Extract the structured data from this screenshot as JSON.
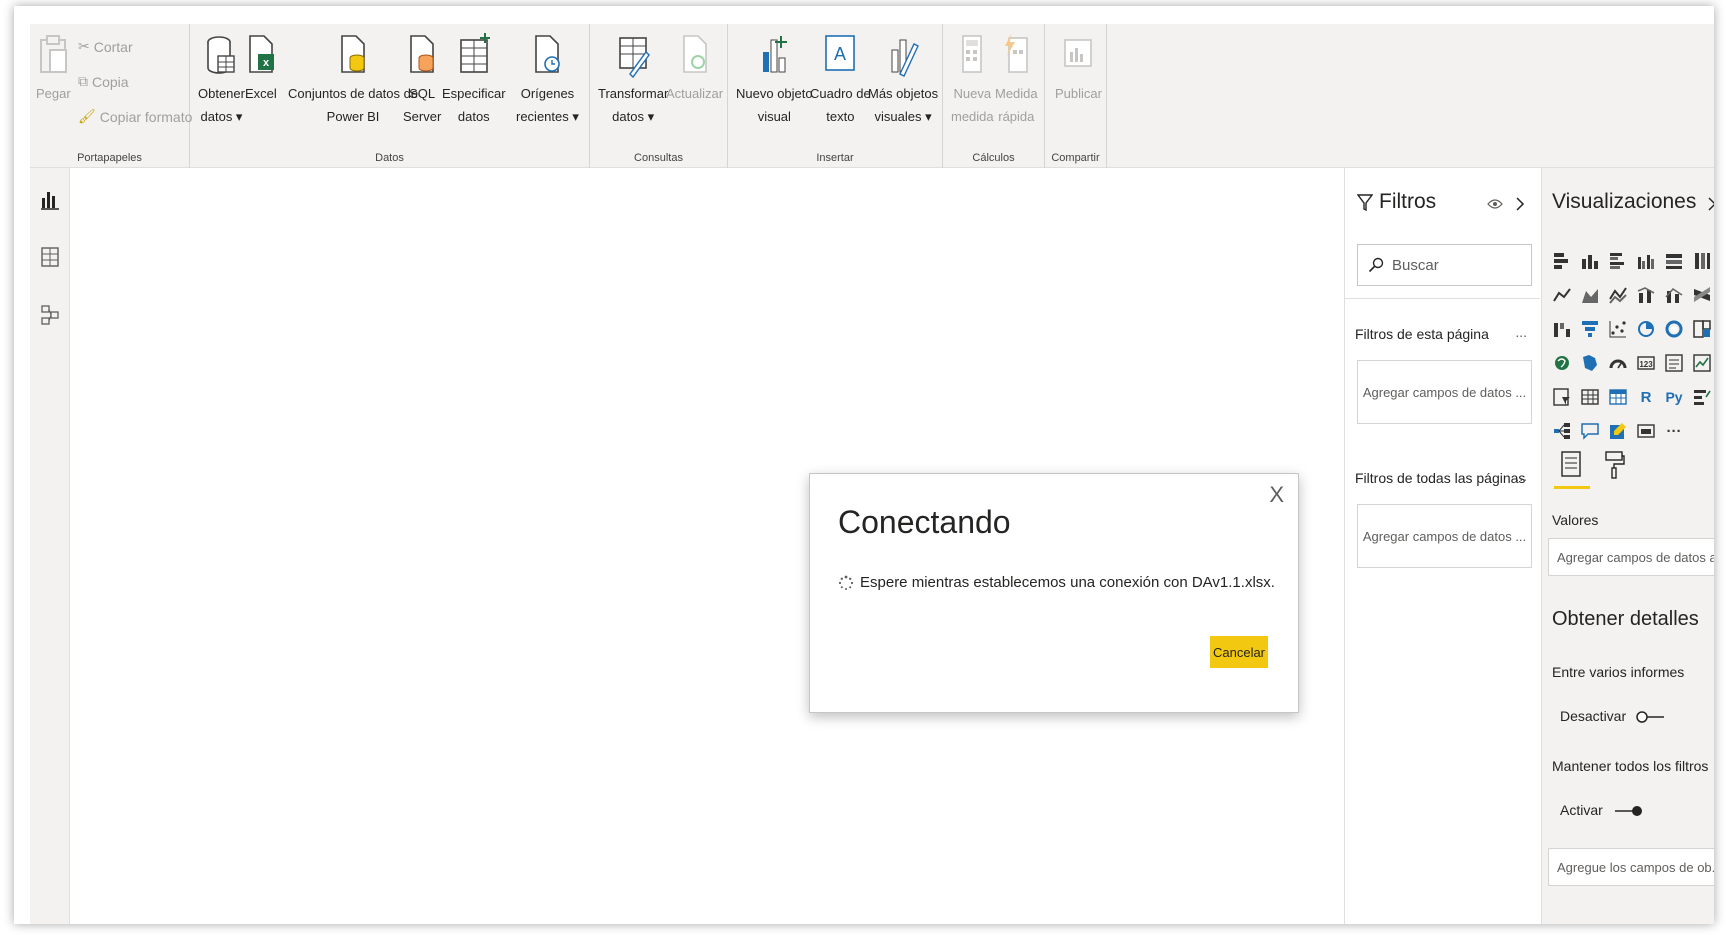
{
  "ribbon": {
    "clipboard": {
      "paste": "Pegar",
      "cut": "Cortar",
      "copy": "Copia",
      "format_painter": "Copiar formato",
      "group": "Portapapeles"
    },
    "data": {
      "get_data_1": "Obtener",
      "get_data_2": "datos ▾",
      "excel": "Excel",
      "powerbi_1": "Conjuntos de datos de",
      "powerbi_2": "Power BI",
      "sql_1": "SQL",
      "sql_2": "Server",
      "enter_1": "Especificar",
      "enter_2": "datos",
      "recent_1": "Orígenes",
      "recent_2": "recientes ▾",
      "group": "Datos"
    },
    "queries": {
      "transform_1": "Transformar",
      "transform_2": "datos ▾",
      "refresh": "Actualizar",
      "group": "Consultas"
    },
    "insert": {
      "new_visual_1": "Nuevo objeto",
      "new_visual_2": "visual",
      "textbox_1": "Cuadro de",
      "textbox_2": "texto",
      "more_visuals_1": "Más objetos",
      "more_visuals_2": "visuales ▾",
      "group": "Insertar"
    },
    "calculations": {
      "new_measure_1": "Nueva",
      "new_measure_2": "medida",
      "quick_measure_1": "Medida",
      "quick_measure_2": "rápida",
      "group": "Cálculos"
    },
    "share": {
      "publish": "Publicar",
      "group": "Compartir"
    }
  },
  "dialog": {
    "close": "X",
    "title": "Conectando",
    "message": "Espere mientras establecemos una conexión con DAv1.1.xlsx.",
    "cancel": "Cancelar"
  },
  "filters": {
    "title": "Filtros",
    "search_placeholder": "Buscar",
    "this_page": "Filtros de esta página",
    "all_pages": "Filtros de todas las páginas",
    "dots": "...",
    "add_fields": "Agregar campos de datos ..."
  },
  "visualizations": {
    "title": "Visualizaciones",
    "values_label": "Valores",
    "values_well": "Agregar campos de datos a...",
    "drillthrough_title": "Obtener detalles",
    "cross_report": "Entre varios informes",
    "off_label": "Desactivar",
    "keep_filters": "Mantener todos los filtros",
    "on_label": "Activar",
    "drill_well": "Agregue los campos de ob...",
    "r_glyph": "R",
    "py_glyph": "Py",
    "more": "···"
  },
  "colors": {
    "accent": "#f2c811",
    "pane_bg": "#f3f2f1",
    "excel_green": "#217346",
    "visual_blue": "#1f6fb5"
  }
}
